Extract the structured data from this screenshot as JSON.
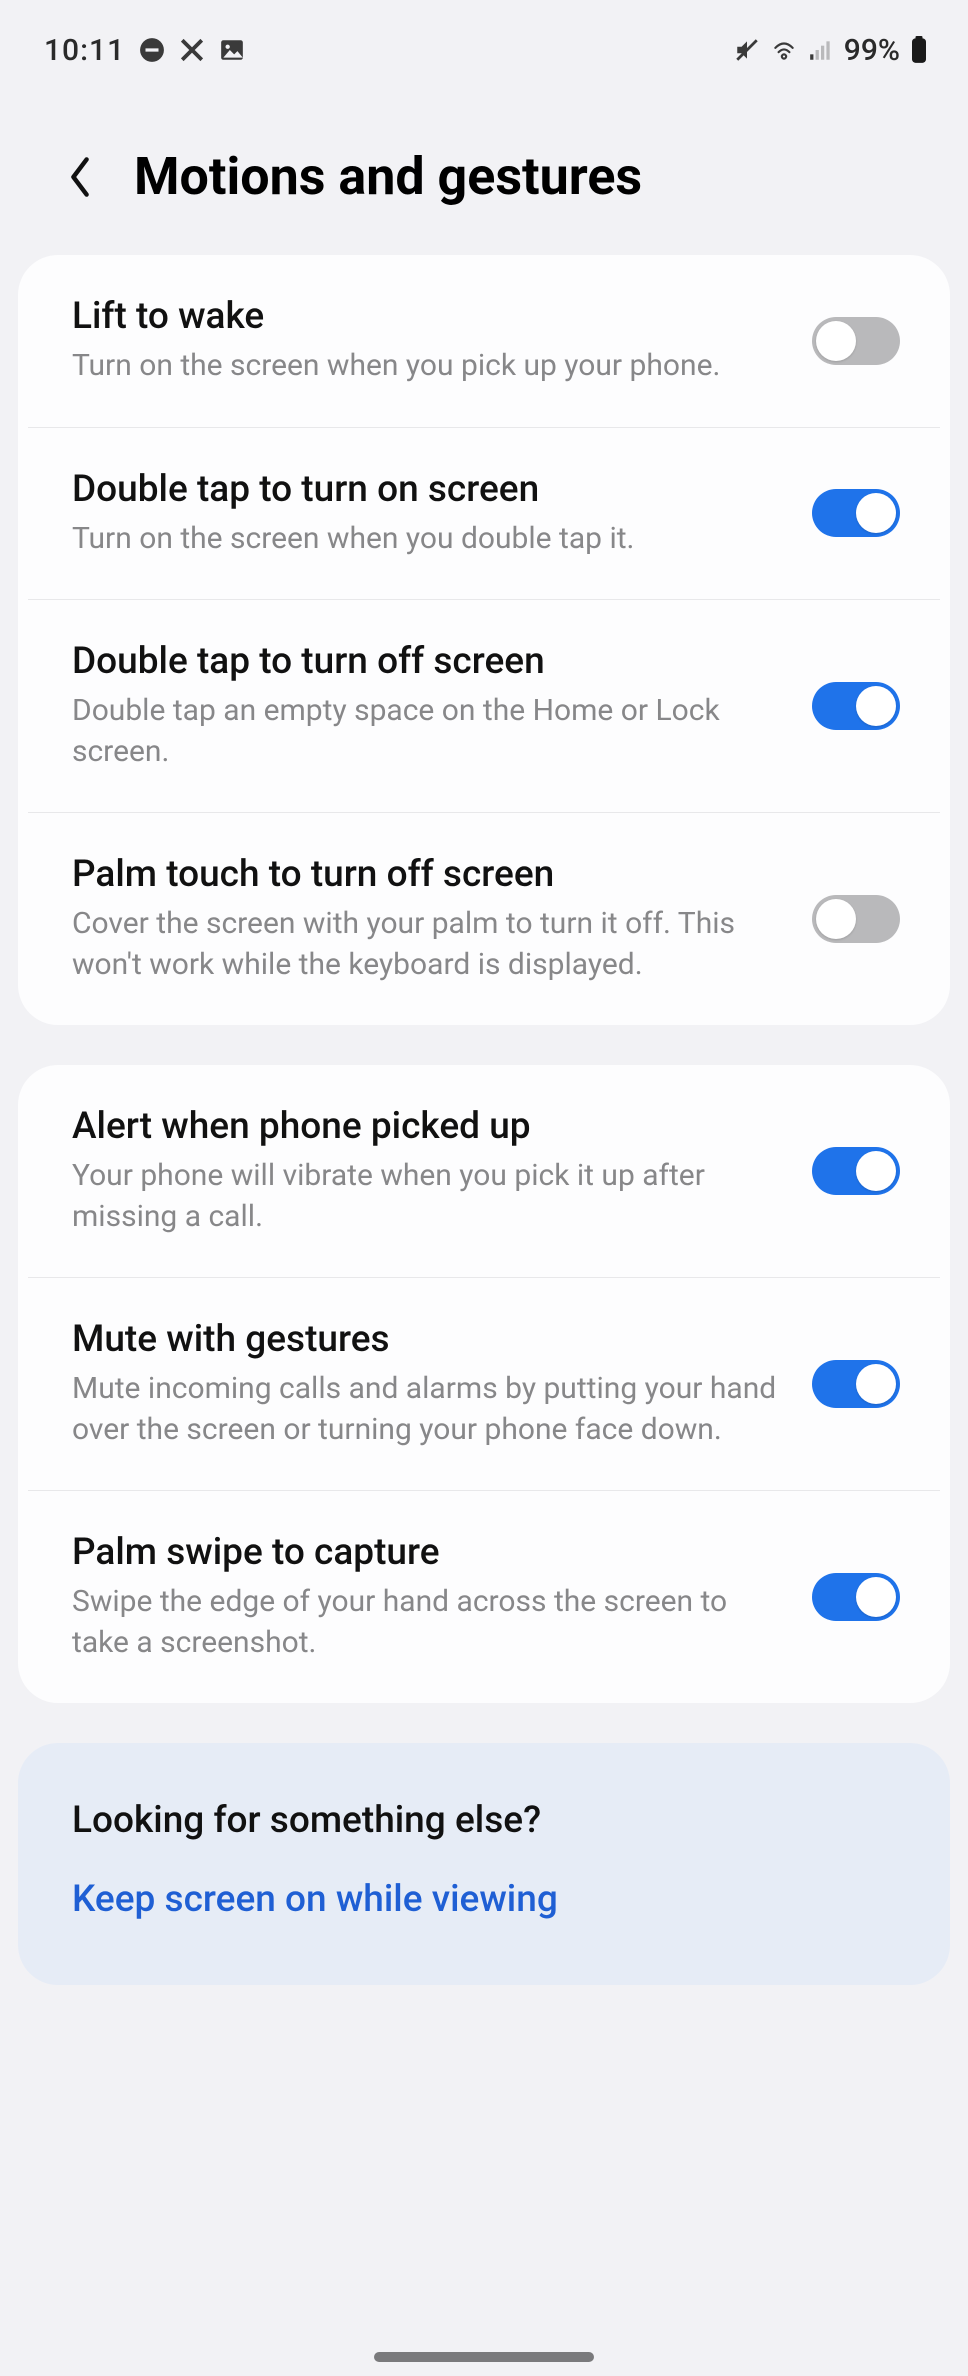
{
  "status": {
    "time": "10:11",
    "battery_text": "99%"
  },
  "header": {
    "title": "Motions and gestures"
  },
  "groups": [
    {
      "items": [
        {
          "title": "Lift to wake",
          "sub": "Turn on the screen when you pick up your phone.",
          "on": false
        },
        {
          "title": "Double tap to turn on screen",
          "sub": "Turn on the screen when you double tap it.",
          "on": true
        },
        {
          "title": "Double tap to turn off screen",
          "sub": "Double tap an empty space on the Home or Lock screen.",
          "on": true
        },
        {
          "title": "Palm touch to turn off screen",
          "sub": "Cover the screen with your palm to turn it off. This won't work while the keyboard is displayed.",
          "on": false
        }
      ]
    },
    {
      "items": [
        {
          "title": "Alert when phone picked up",
          "sub": "Your phone will vibrate when you pick it up after missing a call.",
          "on": true
        },
        {
          "title": "Mute with gestures",
          "sub": "Mute incoming calls and alarms by putting your hand over the screen or turning your phone face down.",
          "on": true
        },
        {
          "title": "Palm swipe to capture",
          "sub": "Swipe the edge of your hand across the screen to take a screenshot.",
          "on": true
        }
      ]
    }
  ],
  "footer": {
    "heading": "Looking for something else?",
    "link": "Keep screen on while viewing"
  }
}
